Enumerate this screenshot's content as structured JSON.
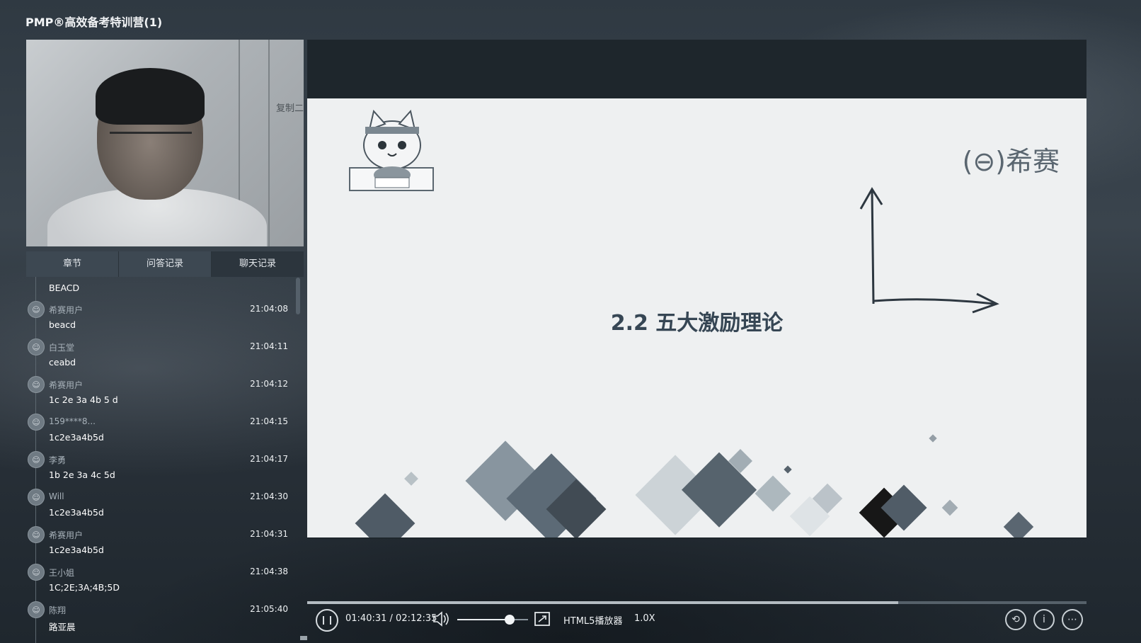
{
  "app": {
    "title": "PMP®高效备考特训营(1)"
  },
  "webcam": {
    "copy_label": "复制二"
  },
  "tabs": [
    {
      "label": "章节"
    },
    {
      "label": "问答记录"
    },
    {
      "label": "聊天记录"
    }
  ],
  "chat": {
    "messages": [
      {
        "user": "",
        "time": "",
        "text": "BEACD"
      },
      {
        "user": "希赛用户",
        "time": "21:04:08",
        "text": "beacd"
      },
      {
        "user": "白玉堂",
        "time": "21:04:11",
        "text": "ceabd"
      },
      {
        "user": "希赛用户",
        "time": "21:04:12",
        "text": "1c 2e 3a 4b 5 d"
      },
      {
        "user": "159****8...",
        "time": "21:04:15",
        "text": "1c2e3a4b5d"
      },
      {
        "user": "李勇",
        "time": "21:04:17",
        "text": "1b 2e 3a 4c 5d"
      },
      {
        "user": "Will",
        "time": "21:04:30",
        "text": "1c2e3a4b5d"
      },
      {
        "user": "希赛用户",
        "time": "21:04:31",
        "text": "1c2e3a4b5d"
      },
      {
        "user": "王小姐",
        "time": "21:04:38",
        "text": "1C;2E;3A;4B;5D"
      },
      {
        "user": "陈翔",
        "time": "21:05:40",
        "text": "路亚晨"
      }
    ]
  },
  "slide": {
    "title": "2.2 五大激励理论",
    "brand": "(⊖)希赛"
  },
  "player": {
    "time_current": "01:40:31",
    "time_total": "02:12:35",
    "progress": 0.758,
    "volume": 0.75,
    "mode_label": "HTML5播放器",
    "speed_label": "1.0X"
  }
}
